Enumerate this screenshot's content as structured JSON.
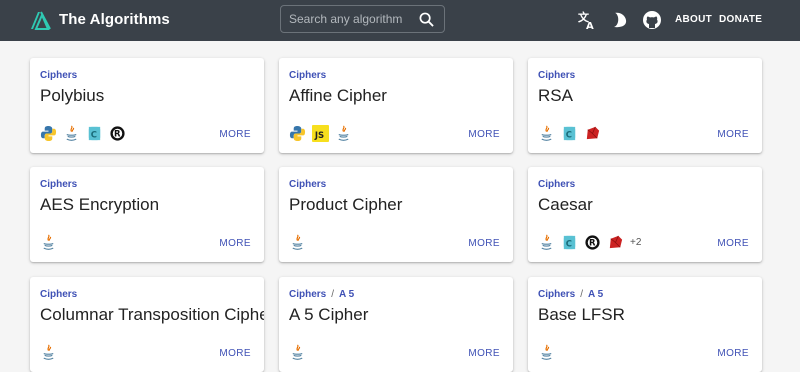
{
  "header": {
    "title": "The Algorithms",
    "search_placeholder": "Search any algorithm",
    "about": "ABOUT",
    "donate": "DONATE",
    "icons": [
      "logo-icon",
      "search-icon",
      "translate-icon",
      "theme-toggle-icon",
      "github-icon"
    ]
  },
  "colors": {
    "topbar": "#3a4149",
    "accent": "#3f51b5",
    "background": "#f5f5f5"
  },
  "cards": [
    {
      "category": "Ciphers",
      "subcategory": "",
      "title": "Polybius",
      "languages": [
        "python",
        "java",
        "c",
        "rust"
      ],
      "extra": "",
      "more": "MORE"
    },
    {
      "category": "Ciphers",
      "subcategory": "",
      "title": "Affine Cipher",
      "languages": [
        "python",
        "javascript",
        "java"
      ],
      "extra": "",
      "more": "MORE"
    },
    {
      "category": "Ciphers",
      "subcategory": "",
      "title": "RSA",
      "languages": [
        "java",
        "c",
        "ruby"
      ],
      "extra": "",
      "more": "MORE"
    },
    {
      "category": "Ciphers",
      "subcategory": "",
      "title": "AES Encryption",
      "languages": [
        "java"
      ],
      "extra": "",
      "more": "MORE"
    },
    {
      "category": "Ciphers",
      "subcategory": "",
      "title": "Product Cipher",
      "languages": [
        "java"
      ],
      "extra": "",
      "more": "MORE"
    },
    {
      "category": "Ciphers",
      "subcategory": "",
      "title": "Caesar",
      "languages": [
        "java",
        "c",
        "rust",
        "ruby"
      ],
      "extra": "+2",
      "more": "MORE"
    },
    {
      "category": "Ciphers",
      "subcategory": "",
      "title": "Columnar Transposition Cipher",
      "languages": [
        "java"
      ],
      "extra": "",
      "more": "MORE"
    },
    {
      "category": "Ciphers",
      "subcategory": "A 5",
      "title": "A 5 Cipher",
      "languages": [
        "java"
      ],
      "extra": "",
      "more": "MORE"
    },
    {
      "category": "Ciphers",
      "subcategory": "A 5",
      "title": "Base LFSR",
      "languages": [
        "java"
      ],
      "extra": "",
      "more": "MORE"
    }
  ]
}
